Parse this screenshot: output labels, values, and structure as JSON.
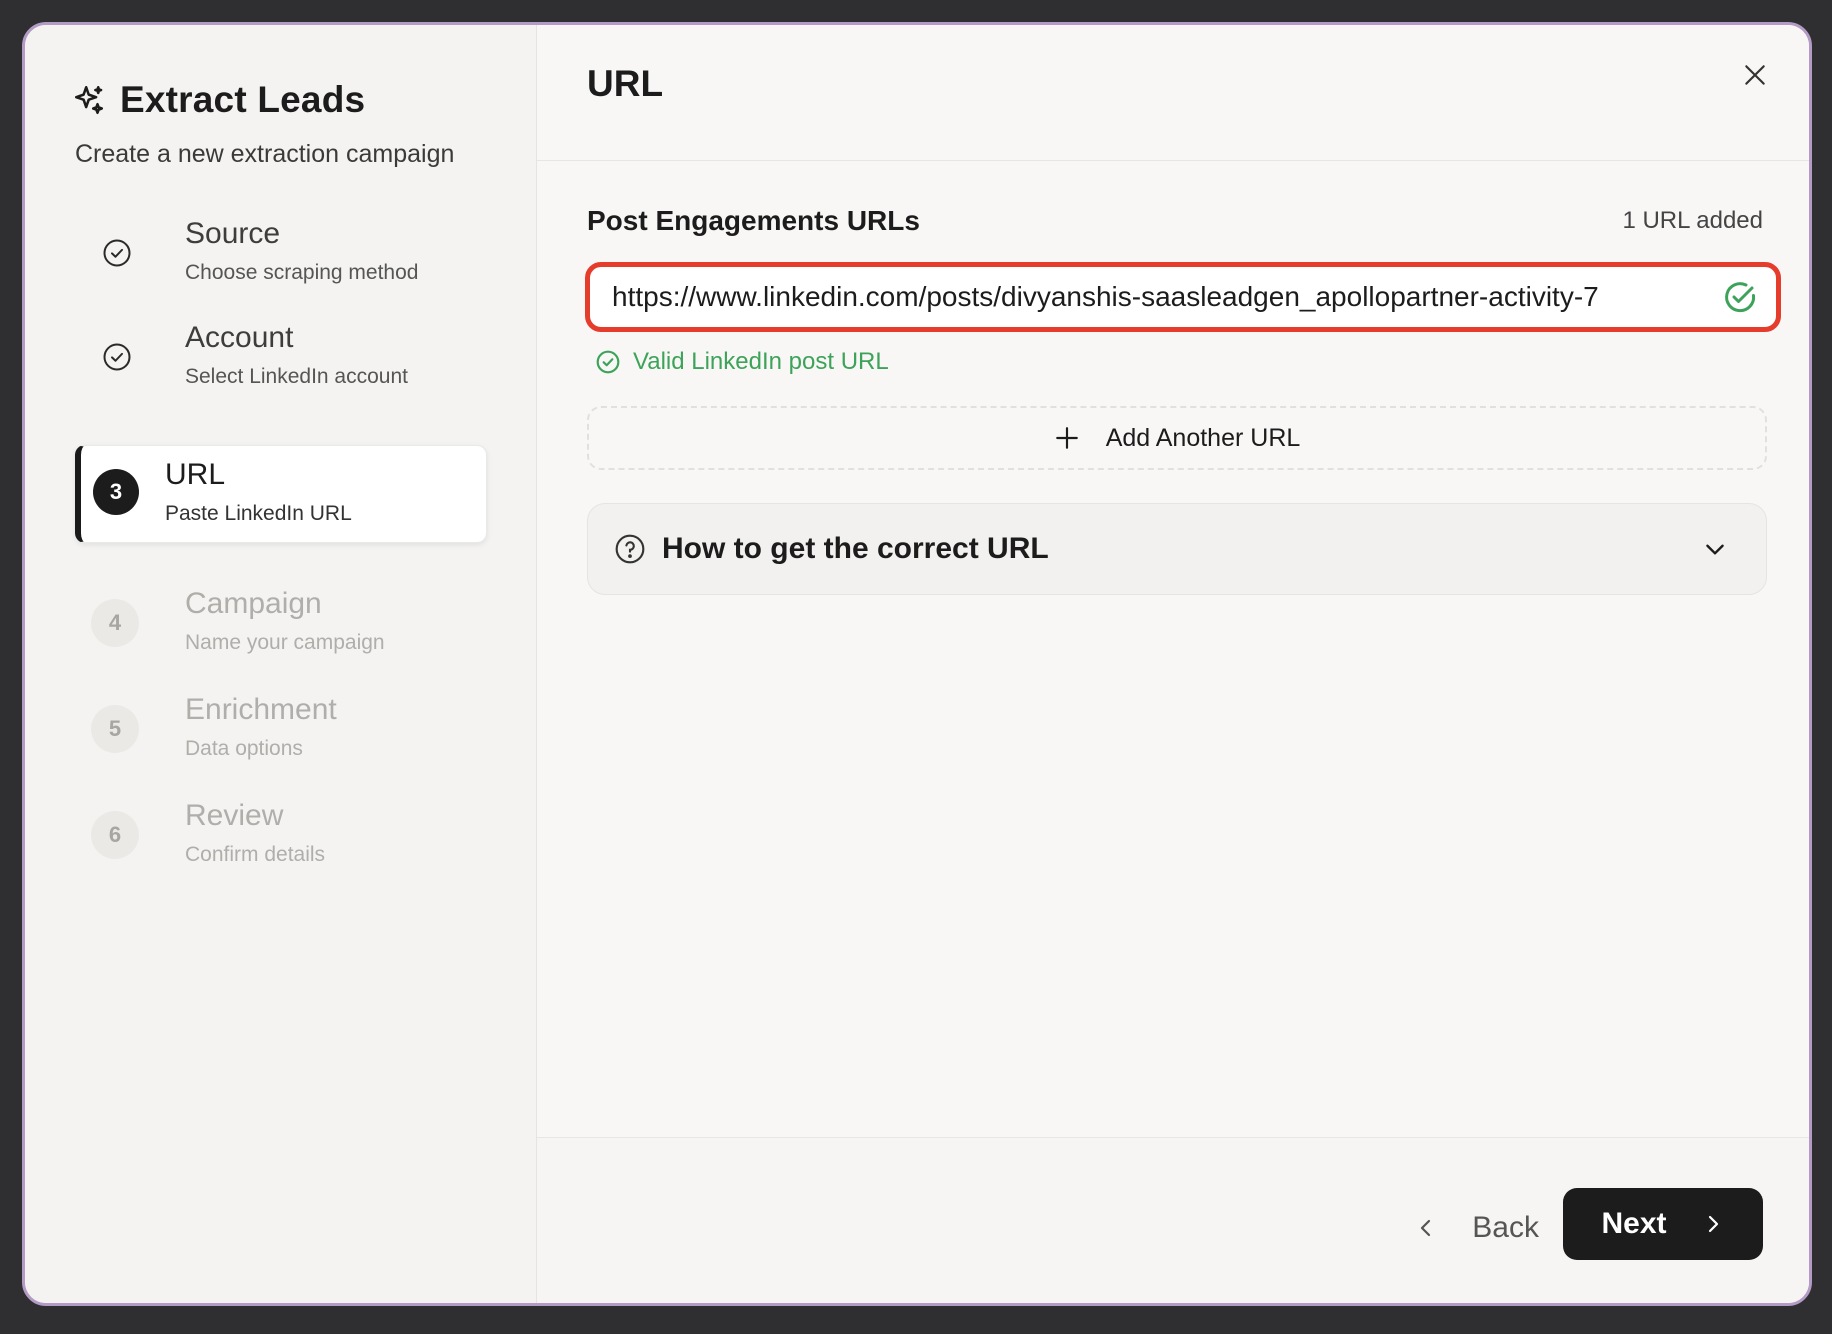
{
  "sidebar": {
    "title": "Extract Leads",
    "subtitle": "Create a new extraction campaign",
    "steps": [
      {
        "marker": "",
        "title": "Source",
        "desc": "Choose scraping method"
      },
      {
        "marker": "",
        "title": "Account",
        "desc": "Select LinkedIn account"
      },
      {
        "marker": "3",
        "title": "URL",
        "desc": "Paste LinkedIn URL"
      },
      {
        "marker": "4",
        "title": "Campaign",
        "desc": "Name your campaign"
      },
      {
        "marker": "5",
        "title": "Enrichment",
        "desc": "Data options"
      },
      {
        "marker": "6",
        "title": "Review",
        "desc": "Confirm details"
      }
    ]
  },
  "main": {
    "title": "URL",
    "section_label": "Post Engagements URLs",
    "url_count": "1 URL added",
    "url_value": "https://www.linkedin.com/posts/divyanshis-saasleadgen_apollopartner-activity-7",
    "valid_message": "Valid LinkedIn post URL",
    "add_url_label": "Add Another URL",
    "help_label": "How to get the correct URL"
  },
  "footer": {
    "back_label": "Back",
    "next_label": "Next"
  },
  "colors": {
    "accent": "#1c1c1c",
    "highlight_border": "#e53c2c",
    "valid_green": "#3ea35a",
    "modal_border": "#b39bc6"
  }
}
